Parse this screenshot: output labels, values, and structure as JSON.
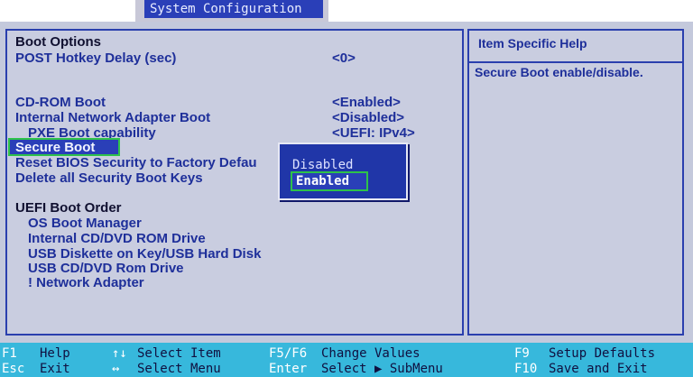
{
  "header": {
    "title": "System Configuration"
  },
  "boot_options": {
    "heading": "Boot Options",
    "post_hotkey_label": "POST Hotkey Delay (sec)",
    "post_hotkey_value": "<0>",
    "cdrom_label": "CD-ROM Boot",
    "cdrom_value": "<Enabled>",
    "network_adapter_label": "Internal Network Adapter Boot",
    "network_adapter_value": "<Disabled>",
    "pxe_label": "PXE Boot capability",
    "pxe_value": "<UEFI: IPv4>",
    "secure_boot_label": "Secure Boot",
    "reset_label": "Reset BIOS Security to Factory Defau",
    "delete_keys_label": "Delete all Security Boot Keys"
  },
  "uefi_boot_order": {
    "heading": "UEFI Boot Order",
    "items": [
      "OS Boot Manager",
      "Internal CD/DVD ROM Drive",
      "USB Diskette on Key/USB Hard Disk",
      "USB CD/DVD Rom Drive",
      "! Network Adapter"
    ]
  },
  "help_panel": {
    "title": "Item Specific Help",
    "text": "Secure Boot enable/disable."
  },
  "popup": {
    "options": [
      "Disabled",
      "Enabled"
    ],
    "selected": "Enabled"
  },
  "footer": {
    "f1_key": "F1",
    "f1_desc": "Help",
    "esc_key": "Esc",
    "esc_desc": "Exit",
    "select_item_key": "↑↓",
    "select_item_desc": "Select Item",
    "select_menu_key": "↔",
    "select_menu_desc": "Select Menu",
    "f5f6_key": "F5/F6",
    "f5f6_desc": "Change Values",
    "enter_key": "Enter",
    "enter_desc": "Select ▶ SubMenu",
    "f9_key": "F9",
    "f9_desc": "Setup Defaults",
    "f10_key": "F10",
    "f10_desc": "Save and Exit"
  },
  "colors": {
    "accent": "#2a3fb8",
    "highlight_border": "#2ec24a",
    "panel_bg": "#c9cde0",
    "footer_bg": "#37b8dc"
  }
}
